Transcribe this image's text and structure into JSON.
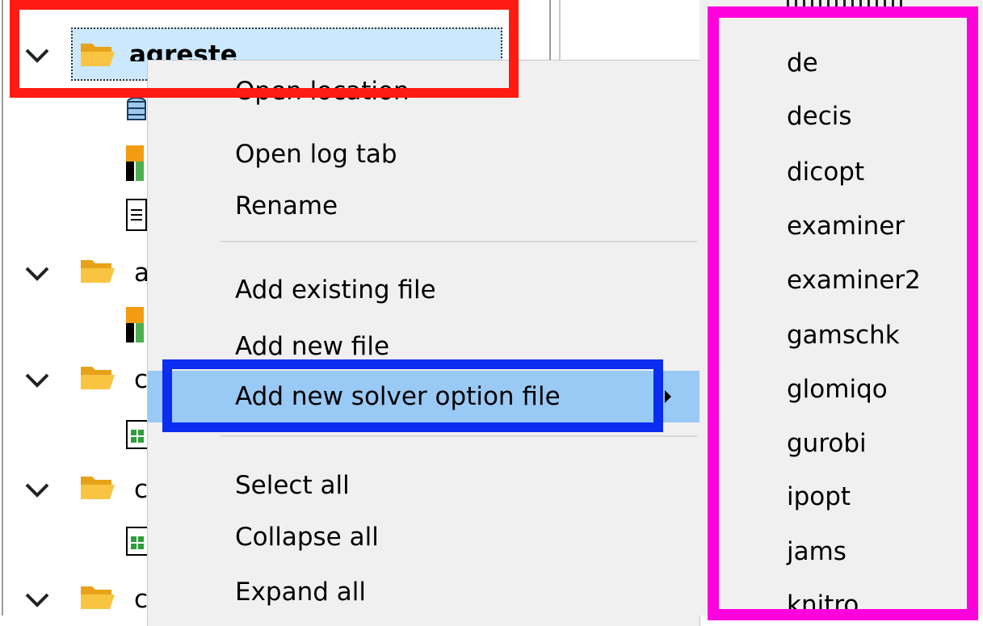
{
  "tree": {
    "selected_project": "agreste",
    "collapsed_projects": [
      "a",
      "c",
      "c",
      "c"
    ]
  },
  "context_menu": {
    "items": [
      {
        "label": "Open location"
      },
      {
        "label": "Open log tab"
      },
      {
        "label": "Rename"
      },
      {
        "label": "Add existing file"
      },
      {
        "label": "Add new file"
      },
      {
        "label": "Add new solver option file",
        "has_submenu": true,
        "highlighted": true
      },
      {
        "label": "Select all"
      },
      {
        "label": "Collapse all"
      },
      {
        "label": "Expand all"
      }
    ]
  },
  "solver_submenu": {
    "items": [
      "de",
      "decis",
      "dicopt",
      "examiner",
      "examiner2",
      "gamschk",
      "glomiqo",
      "gurobi",
      "ipopt",
      "jams",
      "knitro"
    ]
  },
  "colors": {
    "annotation_red": "#ff1a12",
    "annotation_blue": "#0a2df0",
    "annotation_magenta": "#ff00dd",
    "menu_highlight": "#99c9f5",
    "selection_bg": "#cce8ff",
    "folder_yellow": "#f6b93b"
  }
}
